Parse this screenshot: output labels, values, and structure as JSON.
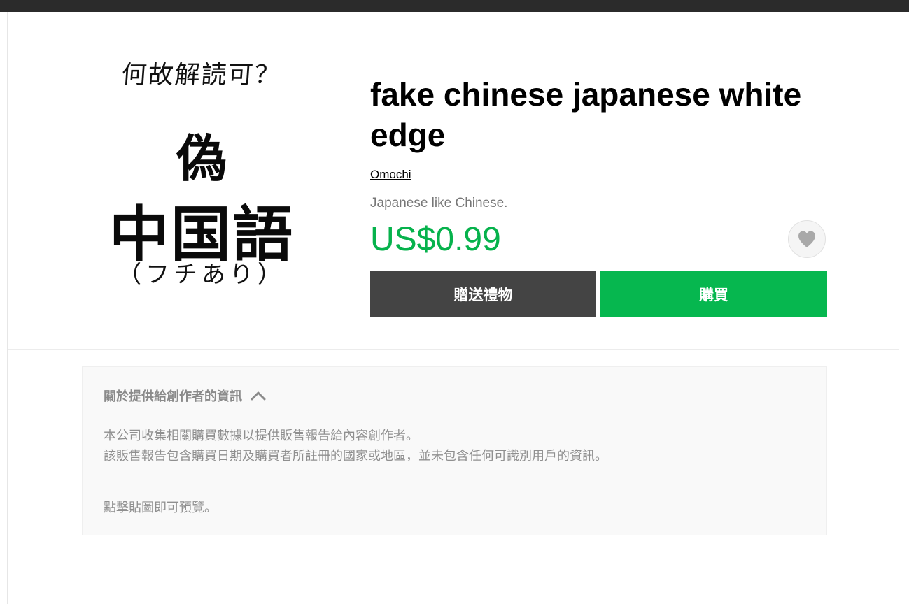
{
  "product": {
    "title": "fake chinese japanese white edge",
    "author": "Omochi",
    "description": "Japanese like Chinese.",
    "price": "US$0.99",
    "favorite_icon": "heart-icon"
  },
  "thumbnail": {
    "caption": "何故解読可？",
    "line1": "偽",
    "line2": "中国語",
    "line3": "（フチあり）"
  },
  "actions": {
    "gift_label": "贈送禮物",
    "buy_label": "購買"
  },
  "info": {
    "title": "關於提供給創作者的資訊",
    "toggle_icon": "chevron-up-icon",
    "line1": "本公司收集相關購買數據以提供販售報告給內容創作者。",
    "line2": "該販售報告包含購買日期及購買者所註冊的國家或地區，並未包含任何可識別用戶的資訊。",
    "note": "點擊貼圖即可預覽。"
  },
  "colors": {
    "price": "#06b24c",
    "buy_button": "#06b74f",
    "gift_button": "#444444"
  }
}
